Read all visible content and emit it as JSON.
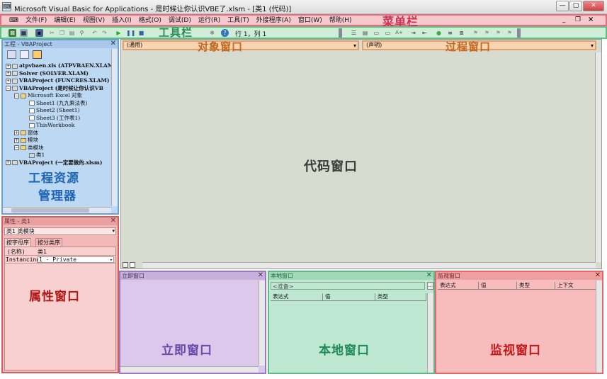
{
  "window": {
    "title": "Microsoft Visual Basic for Applications - 是时候让你认识VBE了.xlsm - [类1 (代码)]",
    "controls": [
      "—",
      "▢",
      "✕"
    ]
  },
  "menubar": {
    "items": [
      "文件(F)",
      "编辑(E)",
      "视图(V)",
      "插入(I)",
      "格式(O)",
      "调试(D)",
      "运行(R)",
      "工具(T)",
      "外接程序(A)",
      "窗口(W)",
      "帮助(H)"
    ],
    "label": "菜单栏",
    "mdi_controls": [
      "_",
      "❐",
      "×"
    ]
  },
  "toolbar": {
    "label": "工具栏",
    "position": "行 1，列 1"
  },
  "project": {
    "title": "工程 - VBAProject",
    "label_line1": "工程资源",
    "label_line2": "管理器",
    "tree": [
      {
        "text": "atpvbaen.xls (ATPVBAEN.XLAM)",
        "indent": 0,
        "box": "+",
        "icon": "project"
      },
      {
        "text": "Solver (SOLVER.XLAM)",
        "indent": 0,
        "box": "+",
        "icon": "project"
      },
      {
        "text": "VBAProject (FUNCRES.XLAM)",
        "indent": 0,
        "box": "+",
        "icon": "project"
      },
      {
        "text": "VBAProject (是时候让你认识VB",
        "indent": 0,
        "box": "−",
        "icon": "project"
      },
      {
        "text": "Microsoft Excel 对象",
        "indent": 1,
        "box": "−",
        "icon": "folder"
      },
      {
        "text": "Sheet1 (九九乘法表)",
        "indent": 2,
        "box": "",
        "icon": "sheet"
      },
      {
        "text": "Sheet2 (Sheet1)",
        "indent": 2,
        "box": "",
        "icon": "sheet"
      },
      {
        "text": "Sheet3 (工作表1)",
        "indent": 2,
        "box": "",
        "icon": "sheet"
      },
      {
        "text": "ThisWorkbook",
        "indent": 2,
        "box": "",
        "icon": "sheet"
      },
      {
        "text": "窗体",
        "indent": 1,
        "box": "+",
        "icon": "folder"
      },
      {
        "text": "模块",
        "indent": 1,
        "box": "+",
        "icon": "folder"
      },
      {
        "text": "类模块",
        "indent": 1,
        "box": "−",
        "icon": "folder"
      },
      {
        "text": "类1",
        "indent": 2,
        "box": "",
        "icon": "class"
      },
      {
        "text": "VBAProject (一定要做的.xlsm)",
        "indent": 0,
        "box": "+",
        "icon": "project"
      }
    ]
  },
  "properties": {
    "title": "属性 - 类1",
    "object_select": "类1 类模块",
    "tabs": [
      "按字母序",
      "按分类序"
    ],
    "rows": [
      {
        "name": "(名称)",
        "value": "类1"
      },
      {
        "name": "Instancing",
        "value": "1 - Private"
      }
    ],
    "label": "属性窗口"
  },
  "code": {
    "object_combo": "(通用)",
    "procedure_combo": "(声明)",
    "object_label": "对象窗口",
    "procedure_label": "过程窗口",
    "label": "代码窗口"
  },
  "immediate": {
    "title": "立即窗口",
    "label": "立即窗口"
  },
  "locals": {
    "title": "本地窗口",
    "status": "<准备>",
    "columns": [
      "表达式",
      "值",
      "类型"
    ],
    "label": "本地窗口"
  },
  "watch": {
    "title": "监视窗口",
    "columns": [
      "表达式",
      "值",
      "类型",
      "上下文"
    ],
    "label": "监视窗口"
  },
  "colors": {
    "menubar": "#f7c9cf",
    "toolbar": "#cfeed8",
    "project": "#bcd8f2",
    "properties": "#f3b8b8",
    "immediate": "#dcc8ea",
    "locals": "#bfe8d2",
    "watch": "#f8bcbc"
  }
}
